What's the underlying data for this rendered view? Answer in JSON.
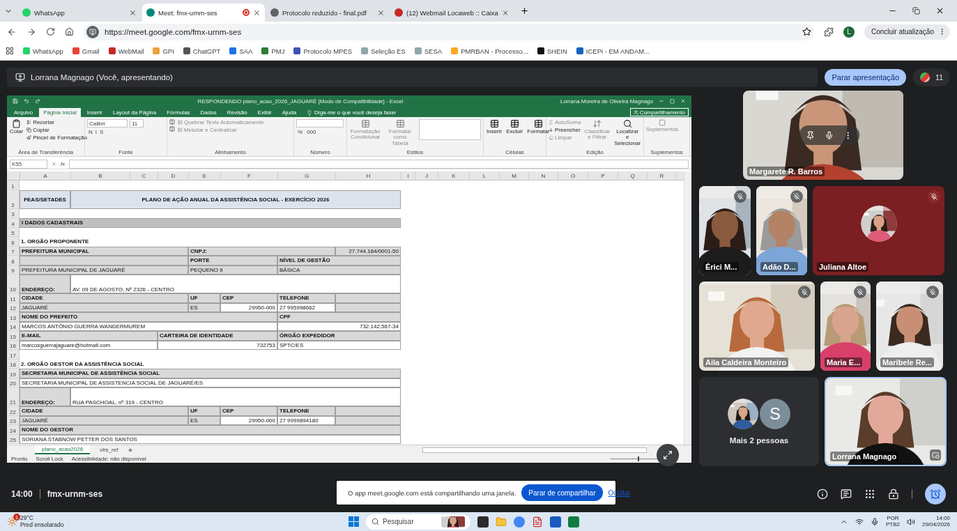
{
  "browser": {
    "tabs": [
      {
        "title": "WhatsApp",
        "selected": false,
        "sharing": false
      },
      {
        "title": "Meet: fmx-urnm-ses",
        "selected": true,
        "sharing": true
      },
      {
        "title": "Protocolo reduzido - final.pdf",
        "selected": false,
        "sharing": false
      },
      {
        "title": "(12) Webmail Locaweb :: Caixa",
        "selected": false,
        "sharing": false
      }
    ],
    "url": "https://meet.google.com/fmx-urnm-ses",
    "profile_initial": "L",
    "update_button": "Concluir atualização",
    "bookmarks": [
      "WhatsApp",
      "Gmail",
      "WebMail",
      "GPI",
      "ChatGPT",
      "SAA",
      "PMJ",
      "Protocolo MPES",
      "Seleção ES",
      "SESA",
      "PMRBAN - Processo...",
      "SHEIN",
      "ICEPi - EM ANDAM..."
    ]
  },
  "meet": {
    "presenter_label": "Lorrana Magnago (Você, apresentando)",
    "stop_presenting": "Parar apresentação",
    "participant_count": "11",
    "tiles": [
      {
        "kind": "video",
        "name": "Margarete R. Barros",
        "muted": false,
        "hover": true
      },
      {
        "kind": "video",
        "name": "Érici M...",
        "muted": true,
        "hover": false
      },
      {
        "kind": "video",
        "name": "Adão D...",
        "muted": true,
        "hover": false
      },
      {
        "kind": "avatar",
        "name": "Juliana Altoe",
        "muted": true,
        "color": "#7b1f22"
      },
      {
        "kind": "video",
        "name": "Aila Caldeira Monteiro",
        "muted": true,
        "hover": false
      },
      {
        "kind": "video",
        "name": "Maria E...",
        "muted": true,
        "hover": false
      },
      {
        "kind": "video",
        "name": "Maribele Re...",
        "muted": true,
        "hover": false
      },
      {
        "kind": "more",
        "name": "Mais 2 pessoas",
        "initial": "S"
      },
      {
        "kind": "self",
        "name": "Lorrana Magnago",
        "muted": false,
        "hover": false
      }
    ],
    "meeting_time": "14:00",
    "meeting_code": "fmx-urnm-ses",
    "share_notice": {
      "text": "O app meet.google.com está compartilhando uma janela.",
      "stop": "Parar de compartilhar",
      "hide": "Ocultar"
    }
  },
  "excel": {
    "title": "RESPONDENDO plano_acao_2026_JAGUARÉ [Modo de Compatibilidade] - Excel",
    "user": "Lorrana Moreira de Oliveira Magnago",
    "ribbon_tabs": [
      {
        "label": "Arquivo",
        "selected": false
      },
      {
        "label": "Página Inicial",
        "selected": true
      },
      {
        "label": "Inserir",
        "selected": false
      },
      {
        "label": "Layout da Página",
        "selected": false
      },
      {
        "label": "Fórmulas",
        "selected": false
      },
      {
        "label": "Dados",
        "selected": false
      },
      {
        "label": "Revisão",
        "selected": false
      },
      {
        "label": "Exibir",
        "selected": false
      },
      {
        "label": "Ajuda",
        "selected": false
      }
    ],
    "tell_me": "Diga-me o que você deseja fazer",
    "share": "Compartilhamento",
    "ribbon_groups": [
      {
        "kind": "clipboard",
        "label": "Área de Transferência",
        "big": [
          {
            "label": "Colar",
            "disabled": false
          }
        ],
        "small": [
          {
            "label": "Recortar",
            "disabled": false
          },
          {
            "label": "Copiar",
            "disabled": false
          },
          {
            "label": "Pincel de Formatação",
            "disabled": false
          }
        ]
      },
      {
        "kind": "font",
        "label": "Fonte",
        "font": "Calibri",
        "size": "11",
        "styles": [
          "N",
          "I",
          "S"
        ]
      },
      {
        "kind": "alignment",
        "label": "Alinhamento",
        "small": [
          {
            "label": "Quebrar Texto Automaticamente",
            "disabled": true
          },
          {
            "label": "Mesclar e Centralizar",
            "disabled": true
          }
        ]
      },
      {
        "kind": "number",
        "label": "Número",
        "symbols": [
          "%",
          "000"
        ]
      },
      {
        "kind": "styles",
        "label": "Estilos",
        "big": [
          {
            "label": "Formatação Condicional",
            "disabled": true
          },
          {
            "label": "Formatar como Tabela",
            "disabled": true
          }
        ]
      },
      {
        "kind": "cells",
        "label": "Células",
        "big": [
          {
            "label": "Inserir",
            "disabled": false
          },
          {
            "label": "Excluir",
            "disabled": false
          },
          {
            "label": "Formatar",
            "disabled": false
          }
        ]
      },
      {
        "kind": "editing",
        "label": "Edição",
        "small": [
          {
            "label": "AutoSoma",
            "disabled": true
          },
          {
            "label": "Preencher",
            "disabled": false
          },
          {
            "label": "Limpar",
            "disabled": true
          }
        ],
        "big": [
          {
            "label": "Classificar e Filtrar",
            "disabled": true
          },
          {
            "label": "Localizar e Selecionar",
            "disabled": false
          }
        ]
      },
      {
        "kind": "addins",
        "label": "Suplementos",
        "big": [
          {
            "label": "Suplementos",
            "disabled": true
          }
        ]
      }
    ],
    "name_box": "K55",
    "function_label": "fx",
    "columns": [
      "A",
      "B",
      "C",
      "D",
      "E",
      "F",
      "G",
      "H",
      "I",
      "J",
      "K",
      "L",
      "M",
      "N",
      "O",
      "P",
      "Q",
      "R"
    ],
    "rows": [
      {
        "number": "1",
        "tall": false
      },
      {
        "number": "2",
        "tall": true,
        "cells": [
          {
            "kind": "title",
            "text": "FEAS/SETADES"
          },
          {
            "kind": "title",
            "text": "PLANO DE AÇÃO ANUAL DA ASSISTÊNCIA SOCIAL - EXERCÍCIO 2026"
          }
        ]
      },
      {
        "number": "3",
        "tall": false
      },
      {
        "number": "4",
        "tall": false,
        "cells": [
          {
            "kind": "band",
            "text": "I DADOS CADASTRAIS"
          }
        ]
      },
      {
        "number": "5",
        "tall": false
      },
      {
        "number": "6",
        "tall": false,
        "cells": [
          {
            "kind": "section",
            "text": "1. ORGÃO PROPONENTE"
          }
        ]
      },
      {
        "number": "7",
        "tall": false,
        "cells": [
          {
            "kind": "label",
            "text": "PREFEITURA MUNICIPAL"
          },
          {
            "kind": "label",
            "text": "CNPJ:"
          },
          {
            "kind": "gray_right",
            "text": "27.744.184/0001-50"
          }
        ]
      },
      {
        "number": "8",
        "tall": false,
        "cells": [
          {
            "kind": "gray"
          },
          {
            "kind": "label",
            "text": "PORTE"
          },
          {
            "kind": "label",
            "text": "NÍVEL DE GESTÃO"
          }
        ]
      },
      {
        "number": "9",
        "tall": false,
        "cells": [
          {
            "kind": "gray",
            "text": "PREFEITURA MUNICIPAL DE JAGUARÉ"
          },
          {
            "kind": "gray",
            "text": "PEQUENO II"
          },
          {
            "kind": "gray",
            "text": "BÁSICA"
          }
        ]
      },
      {
        "number": "10",
        "tall": true,
        "cells": [
          {
            "kind": "label",
            "text": "ENDEREÇO:"
          },
          {
            "kind": "white",
            "text": "AV. 09 DE AGOSTO, Nº 2326 - CENTRO"
          }
        ]
      },
      {
        "number": "11",
        "tall": false,
        "cells": [
          {
            "kind": "label",
            "text": "CIDADE"
          },
          {
            "kind": "label",
            "text": "UF"
          },
          {
            "kind": "label",
            "text": "CEP"
          },
          {
            "kind": "label",
            "text": "TELEFONE"
          },
          {
            "kind": "gray"
          }
        ]
      },
      {
        "number": "12",
        "tall": false,
        "cells": [
          {
            "kind": "gray",
            "text": "JAGUARÉ"
          },
          {
            "kind": "gray",
            "text": "ES"
          },
          {
            "kind": "number",
            "text": "29950-000"
          },
          {
            "kind": "white",
            "text": "27 995998662"
          },
          {
            "kind": "gray"
          }
        ]
      },
      {
        "number": "13",
        "tall": false,
        "cells": [
          {
            "kind": "label",
            "text": "NOME DO PREFEITO"
          },
          {
            "kind": "label",
            "text": "CPF"
          }
        ]
      },
      {
        "number": "14",
        "tall": false,
        "cells": [
          {
            "kind": "white",
            "text": "MARCOS ANTÔNIO GUERRA WANDERMUREM"
          },
          {
            "kind": "number",
            "text": "732.142.567-34"
          }
        ]
      },
      {
        "number": "15",
        "tall": false,
        "cells": [
          {
            "kind": "label",
            "text": "E-MAIL"
          },
          {
            "kind": "label",
            "text": "CARTEIRA DE IDENTIDADE"
          },
          {
            "kind": "label",
            "text": "ÓRGÃO EXPEDIDOR"
          }
        ]
      },
      {
        "number": "16",
        "tall": false,
        "cells": [
          {
            "kind": "white",
            "text": "marcosguerrajaguare@hotmail.com"
          },
          {
            "kind": "number",
            "text": "732753"
          },
          {
            "kind": "white",
            "text": "SPTC/ES"
          }
        ]
      },
      {
        "number": "17",
        "tall": false
      },
      {
        "number": "18",
        "tall": false,
        "cells": [
          {
            "kind": "section",
            "text": "2. ORGÃO GESTOR DA ASSISTÊNCIA SOCIAL"
          }
        ]
      },
      {
        "number": "19",
        "tall": false,
        "cells": [
          {
            "kind": "label",
            "text": "SECRETARIA MUNICIPAL DE ASSISTÊNCIA SOCIAL"
          }
        ]
      },
      {
        "number": "20",
        "tall": false,
        "cells": [
          {
            "kind": "white",
            "text": "SECRETARIA MUNICIPAL DE ASSISTENCIA SOCIAL DE JAGUARÉ/ES"
          }
        ]
      },
      {
        "number": "21",
        "tall": true,
        "cells": [
          {
            "kind": "label",
            "text": "ENDEREÇO:"
          },
          {
            "kind": "white",
            "text": "RUA PASCHOAL, nº 319 - CENTRO"
          }
        ]
      },
      {
        "number": "22",
        "tall": false,
        "cells": [
          {
            "kind": "label",
            "text": "CIDADE"
          },
          {
            "kind": "label",
            "text": "UF"
          },
          {
            "kind": "label",
            "text": "CEP"
          },
          {
            "kind": "label",
            "text": "TELEFONE"
          },
          {
            "kind": "gray"
          }
        ]
      },
      {
        "number": "23",
        "tall": false,
        "cells": [
          {
            "kind": "gray",
            "text": "JAGUARÉ"
          },
          {
            "kind": "gray",
            "text": "ES"
          },
          {
            "kind": "number",
            "text": "29950-000"
          },
          {
            "kind": "white",
            "text": "27 9999894180"
          },
          {
            "kind": "gray"
          }
        ]
      },
      {
        "number": "24",
        "tall": false,
        "cells": [
          {
            "kind": "label",
            "text": "NOME DO GESTOR"
          }
        ]
      },
      {
        "number": "25",
        "tall": false,
        "cells": [
          {
            "kind": "white",
            "text": "SORIANA STABNOW PETTER DOS SANTOS"
          }
        ]
      }
    ],
    "sheets": [
      {
        "label": "plano_acao2026",
        "selected": true
      },
      {
        "label": "vlrs_ref",
        "selected": false
      }
    ],
    "status": [
      "Pronto",
      "Scroll Lock",
      "Acessibilidade: não disponível"
    ],
    "zoom": {
      "level": 0.55
    }
  },
  "taskbar": {
    "temperature": "29°C",
    "weather": "Pred ensolarado",
    "weather_badge": "1",
    "search_placeholder": "Pesquisar",
    "language": "POR",
    "layout": "PTB2",
    "time": "14:00",
    "date": "29/04/2026"
  }
}
